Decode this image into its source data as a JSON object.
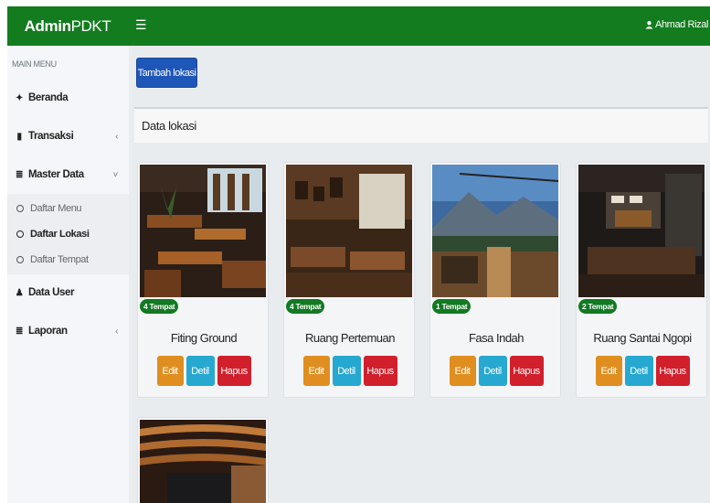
{
  "header": {
    "brand_bold": "Admin",
    "brand_rest": " PDKT",
    "menu_icon": "☰",
    "user_icon": "user-icon",
    "user_name": "Ahmad Rizal"
  },
  "sidebar": {
    "heading": "MAIN MENU",
    "items": [
      {
        "label": "Beranda",
        "icon": "home-icon",
        "glyph": "✦",
        "caret": ""
      },
      {
        "label": "Transaksi",
        "icon": "book-icon",
        "glyph": "▮",
        "caret": "‹"
      },
      {
        "label": "Master Data",
        "icon": "list-icon",
        "glyph": "≣",
        "caret": "˅"
      },
      {
        "label": "Data User",
        "icon": "user-icon",
        "glyph": "♟",
        "caret": ""
      },
      {
        "label": "Laporan",
        "icon": "list-icon",
        "glyph": "≣",
        "caret": "‹"
      }
    ],
    "sub_items": [
      {
        "label": "Daftar Menu",
        "active": false
      },
      {
        "label": "Daftar Lokasi",
        "active": true
      },
      {
        "label": "Daftar Tempat",
        "active": false
      }
    ]
  },
  "main": {
    "add_button": "Tambah lokasi",
    "panel_title": "Data lokasi",
    "cards": [
      {
        "name": "Fiting Ground",
        "badge": "4 Tempat",
        "edit": "Edit",
        "detil": "Detil",
        "hapus": "Hapus"
      },
      {
        "name": "Ruang Pertemuan",
        "badge": "4 Tempat",
        "edit": "Edit",
        "detil": "Detil",
        "hapus": "Hapus"
      },
      {
        "name": "Fasa Indah",
        "badge": "1 Tempat",
        "edit": "Edit",
        "detil": "Detil",
        "hapus": "Hapus"
      },
      {
        "name": "Ruang Santai Ngopi",
        "badge": "2 Tempat",
        "edit": "Edit",
        "detil": "Detil",
        "hapus": "Hapus"
      }
    ]
  },
  "colors": {
    "topbar": "#137c1f",
    "primary": "#1f57b8",
    "badge": "#127a22",
    "edit": "#e08e20",
    "detil": "#26a8d0",
    "hapus": "#d11f2c"
  }
}
